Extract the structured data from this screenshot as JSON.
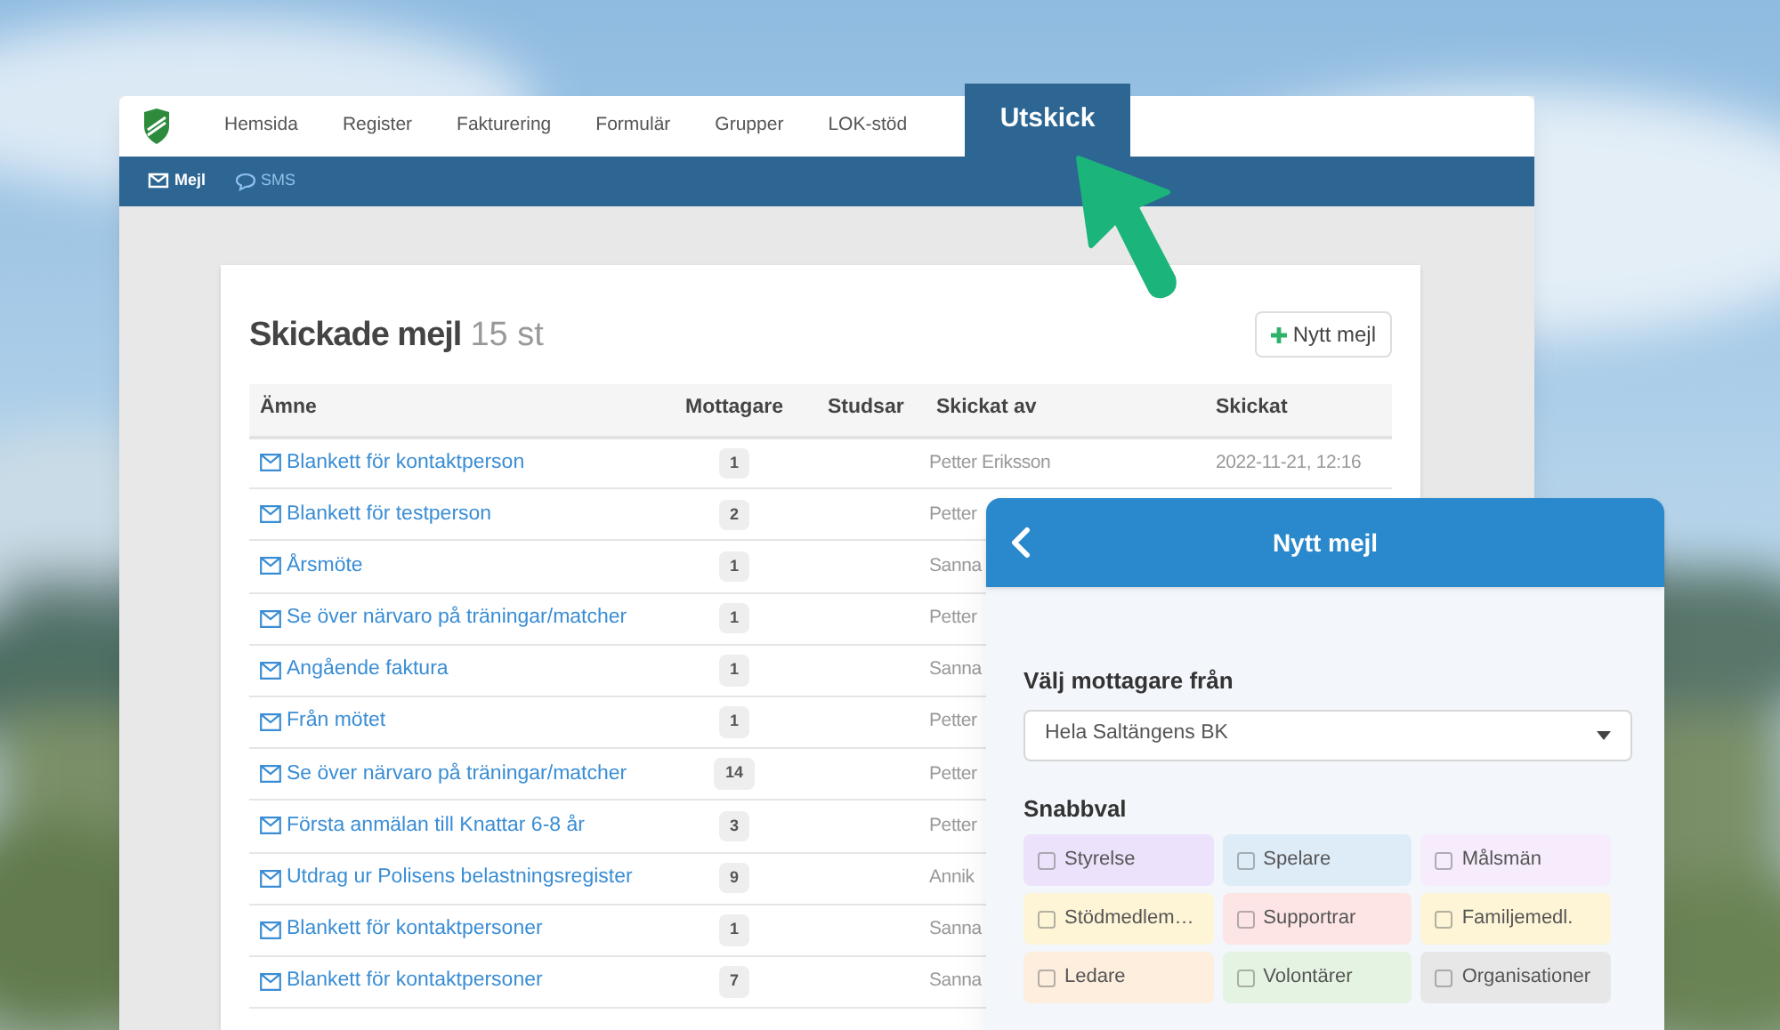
{
  "nav": {
    "tabs": [
      {
        "label": "Hemsida",
        "selected": false
      },
      {
        "label": "Register",
        "selected": false
      },
      {
        "label": "Fakturering",
        "selected": false
      },
      {
        "label": "Formulär",
        "selected": false
      },
      {
        "label": "Grupper",
        "selected": false
      },
      {
        "label": "LOK-stöd",
        "selected": false
      },
      {
        "label": "Utskick",
        "selected": true
      }
    ],
    "subtabs": [
      {
        "label": "Mejl",
        "kind": "mail",
        "selected": true
      },
      {
        "label": "SMS",
        "kind": "chat",
        "selected": false
      }
    ]
  },
  "card": {
    "title": "Skickade mejl",
    "count": "15 st",
    "new_button": "Nytt mejl",
    "table": {
      "columns": [
        "Ämne",
        "Mottagare",
        "Studsar",
        "Skickat av",
        "Skickat"
      ],
      "rows": [
        {
          "subject": "Blankett för kontaktperson",
          "recipients": "1",
          "sender": "Petter Eriksson",
          "sent": "2022-11-21, 12:16"
        },
        {
          "subject": "Blankett för testperson",
          "recipients": "2",
          "sender": "Petter"
        },
        {
          "subject": "Årsmöte",
          "recipients": "1",
          "sender": "Sanna"
        },
        {
          "subject": "Se över närvaro på träningar/matcher",
          "recipients": "1",
          "sender": "Petter"
        },
        {
          "subject": "Angående faktura",
          "recipients": "1",
          "sender": "Sanna"
        },
        {
          "subject": "Från mötet",
          "recipients": "1",
          "sender": "Petter"
        },
        {
          "subject": "Se över närvaro på träningar/matcher",
          "recipients": "14",
          "sender": "Petter"
        },
        {
          "subject": "Första anmälan till Knattar 6-8 år",
          "recipients": "3",
          "sender": "Petter"
        },
        {
          "subject": "Utdrag ur Polisens belastningsregister",
          "recipients": "9",
          "sender": "Annik"
        },
        {
          "subject": "Blankett för kontaktpersoner",
          "recipients": "1",
          "sender": "Sanna"
        },
        {
          "subject": "Blankett för kontaktpersoner",
          "recipients": "7",
          "sender": "Sanna"
        }
      ]
    }
  },
  "panel": {
    "title": "Nytt mejl",
    "recipients_label": "Välj mottagare från",
    "recipients_value": "Hela Saltängens BK",
    "quick_label": "Snabbval",
    "chips": [
      {
        "label": "Styrelse",
        "checked": false,
        "color": "#ece2fb"
      },
      {
        "label": "Spelare",
        "checked": false,
        "color": "#deecf8"
      },
      {
        "label": "Målsmän",
        "checked": false,
        "color": "#f6ecfc"
      },
      {
        "label": "Stödmedlem…",
        "checked": false,
        "color": "#fdf5d6"
      },
      {
        "label": "Supportrar",
        "checked": false,
        "color": "#fde5e5"
      },
      {
        "label": "Familjemedl.",
        "checked": false,
        "color": "#fdf5d6"
      },
      {
        "label": "Ledare",
        "checked": false,
        "color": "#fdeedd"
      },
      {
        "label": "Volontärer",
        "checked": false,
        "color": "#e5f4e2"
      },
      {
        "label": "Organisationer",
        "checked": false,
        "color": "#e7e7e7"
      }
    ]
  }
}
